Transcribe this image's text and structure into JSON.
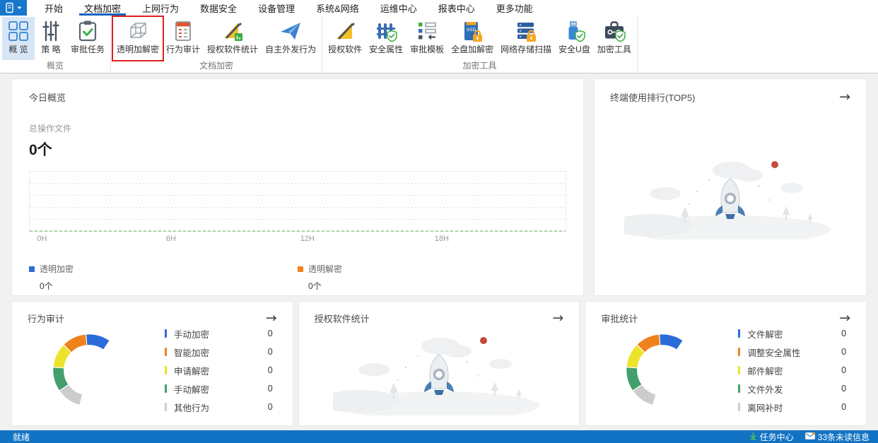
{
  "menu": {
    "app_button": {
      "icon": "app-menu-icon"
    },
    "tabs": [
      {
        "label": "开始",
        "active": false
      },
      {
        "label": "文档加密",
        "active": true
      },
      {
        "label": "上网行为",
        "active": false
      },
      {
        "label": "数据安全",
        "active": false
      },
      {
        "label": "设备管理",
        "active": false
      },
      {
        "label": "系统&网络",
        "active": false
      },
      {
        "label": "运维中心",
        "active": false
      },
      {
        "label": "报表中心",
        "active": false
      },
      {
        "label": "更多功能",
        "active": false
      }
    ]
  },
  "ribbon": {
    "groups": [
      {
        "label": "概览",
        "buttons": [
          {
            "label": "概 览",
            "icon": "overview-grid-icon",
            "selected": true
          },
          {
            "label": "策 略",
            "icon": "policy-sliders-icon"
          },
          {
            "label": "审批任务",
            "icon": "approval-task-icon"
          }
        ]
      },
      {
        "label": "文档加密",
        "buttons": [
          {
            "label": "透明加解密",
            "icon": "transparent-crypt-cube-icon",
            "highlighted": true
          },
          {
            "label": "行为审计",
            "icon": "behavior-audit-icon"
          },
          {
            "label": "授权软件统计",
            "icon": "authorized-software-stats-icon"
          },
          {
            "label": "自主外发行为",
            "icon": "outgoing-behavior-icon"
          }
        ]
      },
      {
        "label": "加密工具",
        "buttons": [
          {
            "label": "授权软件",
            "icon": "authorized-software-icon"
          },
          {
            "label": "安全属性",
            "icon": "security-attribute-icon"
          },
          {
            "label": "审批模板",
            "icon": "approval-template-icon"
          },
          {
            "label": "全盘加解密",
            "icon": "fulldisk-crypt-icon"
          },
          {
            "label": "网络存储扫描",
            "icon": "network-storage-scan-icon"
          },
          {
            "label": "安全U盘",
            "icon": "secure-usb-icon"
          },
          {
            "label": "加密工具",
            "icon": "crypt-tools-icon"
          }
        ]
      }
    ]
  },
  "cards": {
    "today": {
      "title": "今日概览",
      "metric_label": "总操作文件",
      "metric_value": "0个",
      "chart_data": {
        "type": "line",
        "x_ticks": [
          "0H",
          "6H",
          "12H",
          "18H"
        ],
        "x_range_hours": [
          0,
          24
        ],
        "ylim": [
          0,
          1
        ],
        "grid": true,
        "series": [
          {
            "name": "透明加密",
            "color": "#2b6cd9",
            "total": "0个",
            "values": [
              0,
              0,
              0,
              0,
              0,
              0,
              0,
              0,
              0,
              0,
              0,
              0,
              0,
              0,
              0,
              0,
              0,
              0,
              0,
              0,
              0,
              0,
              0,
              0
            ]
          },
          {
            "name": "透明解密",
            "color": "#f0821e",
            "total": "0个",
            "values": [
              0,
              0,
              0,
              0,
              0,
              0,
              0,
              0,
              0,
              0,
              0,
              0,
              0,
              0,
              0,
              0,
              0,
              0,
              0,
              0,
              0,
              0,
              0,
              0
            ]
          }
        ]
      }
    },
    "terminal_rank": {
      "title": "终端使用排行(TOP5)",
      "arrow": "→"
    },
    "behavior_audit": {
      "title": "行为审计",
      "arrow": "→",
      "chart_data": {
        "type": "donut",
        "items": [
          {
            "label": "手动加密",
            "value": 0,
            "color": "#2b6cd9"
          },
          {
            "label": "智能加密",
            "value": 0,
            "color": "#f0821e"
          },
          {
            "label": "申请解密",
            "value": 0,
            "color": "#ece32a"
          },
          {
            "label": "手动解密",
            "value": 0,
            "color": "#43a06d"
          },
          {
            "label": "其他行为",
            "value": 0,
            "color": "#cccccc"
          }
        ]
      }
    },
    "software_stats": {
      "title": "授权软件统计",
      "arrow": "→"
    },
    "approval_stats": {
      "title": "审批统计",
      "arrow": "→",
      "chart_data": {
        "type": "donut",
        "items": [
          {
            "label": "文件解密",
            "value": 0,
            "color": "#2b6cd9"
          },
          {
            "label": "调整安全属性",
            "value": 0,
            "color": "#f0821e"
          },
          {
            "label": "邮件解密",
            "value": 0,
            "color": "#ece32a"
          },
          {
            "label": "文件外发",
            "value": 0,
            "color": "#43a06d"
          },
          {
            "label": "离网补时",
            "value": 0,
            "color": "#cccccc"
          }
        ]
      }
    }
  },
  "statusbar": {
    "ready": "就绪",
    "task_center": "任务中心",
    "unread": "33条未读信息"
  },
  "colors": {
    "accent_blue": "#1565c0",
    "statusbar_blue": "#1273c4",
    "highlight_red": "#e01f1f",
    "selected_ribbon_bg": "#d7e6f6",
    "axis_green": "#7fbf72"
  }
}
